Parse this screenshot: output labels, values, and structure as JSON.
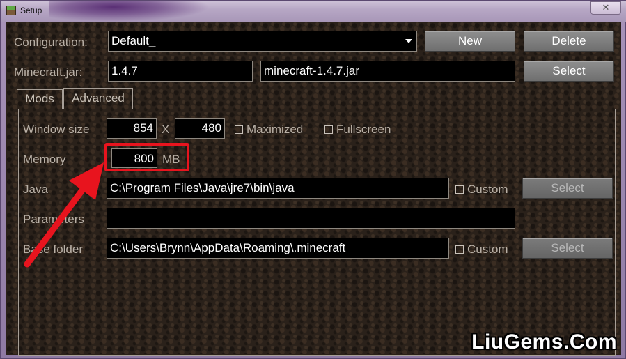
{
  "window": {
    "title": "Setup",
    "close_glyph": "✕"
  },
  "configuration": {
    "label": "Configuration:",
    "value": "Default_",
    "new_label": "New",
    "delete_label": "Delete"
  },
  "minecraft_jar": {
    "label": "Minecraft.jar:",
    "version": "1.4.7",
    "file": "minecraft-1.4.7.jar",
    "select_label": "Select"
  },
  "tabs": [
    {
      "label": "Mods",
      "active": false
    },
    {
      "label": "Advanced",
      "active": true
    }
  ],
  "advanced": {
    "window_size": {
      "label": "Window size",
      "width": "854",
      "separator": "X",
      "height": "480"
    },
    "maximized": {
      "label": "Maximized",
      "checked": false
    },
    "fullscreen": {
      "label": "Fullscreen",
      "checked": false
    },
    "memory": {
      "label": "Memory",
      "value": "800",
      "unit": "MB"
    },
    "java": {
      "label": "Java",
      "path": "C:\\Program Files\\Java\\jre7\\bin\\java",
      "custom_label": "Custom",
      "custom_checked": false,
      "select_label": "Select"
    },
    "parameters": {
      "label": "Parameters",
      "value": ""
    },
    "base_folder": {
      "label": "Base folder",
      "path": "C:\\Users\\Brynn\\AppData\\Roaming\\.minecraft",
      "custom_label": "Custom",
      "custom_checked": false,
      "select_label": "Select"
    }
  },
  "annotation_color": "#e8141e",
  "watermark": "LiuGems.Com"
}
